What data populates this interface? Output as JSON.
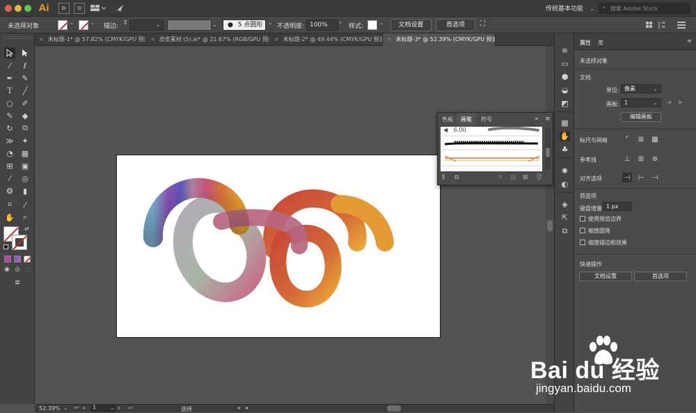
{
  "app": {
    "logo": "Ai",
    "icon_br": "Br",
    "icon_st": "St",
    "workspace": "传统基本功能",
    "search_placeholder": "搜索 Adobe Stock"
  },
  "control": {
    "selection_status": "未选择对象",
    "stroke_label": "描边:",
    "brush_value": "5 点圆形",
    "opacity_label": "不透明度:",
    "opacity_value": "100%",
    "style_label": "样式:",
    "doc_setup": "文档设置",
    "preferences": "首选项"
  },
  "tabs": [
    {
      "label": "未标题-1* @ 57.82% (CMYK/GPU 预览)",
      "active": false
    },
    {
      "label": "皮皮素材 (5).ai* @ 21.67% (RGB/GPU 预览)",
      "active": false
    },
    {
      "label": "未标题-2* @ 49.44% (CMYK/GPU 预览)",
      "active": false
    },
    {
      "label": "未标题-3* @ 52.39% (CMYK/GPU 预览)",
      "active": true
    }
  ],
  "status": {
    "zoom": "52.39%",
    "artboard_number": "1",
    "tool_name": "选择"
  },
  "brushes_panel": {
    "tabs": [
      "色板",
      "画笔",
      "符号"
    ],
    "active_tab": "画笔",
    "size_readout": "6.00"
  },
  "properties": {
    "tab_properties": "属性",
    "tab_library": "库",
    "selection": "未选择对象",
    "document_title": "文档",
    "units_label": "单位:",
    "units_value": "像素",
    "artboard_label": "画板:",
    "artboard_value": "1",
    "edit_artboards": "编辑画板",
    "rulers_grids": "标尺与网格",
    "guides": "参考线",
    "snap_options": "对齐选项",
    "preferences_title": "首选项",
    "keyboard_increment_label": "键盘增量:",
    "keyboard_increment_value": "1 px",
    "checkboxes": [
      {
        "label": "使用预览边界",
        "checked": false
      },
      {
        "label": "缩放圆角",
        "checked": false
      },
      {
        "label": "缩放描边和效果",
        "checked": false
      }
    ],
    "quick_actions": "快速操作",
    "doc_setup_btn": "文档设置",
    "preferences_btn": "首选项"
  },
  "watermark": {
    "brand": "Bai du 经验",
    "url": "jingyan.baidu.com"
  }
}
